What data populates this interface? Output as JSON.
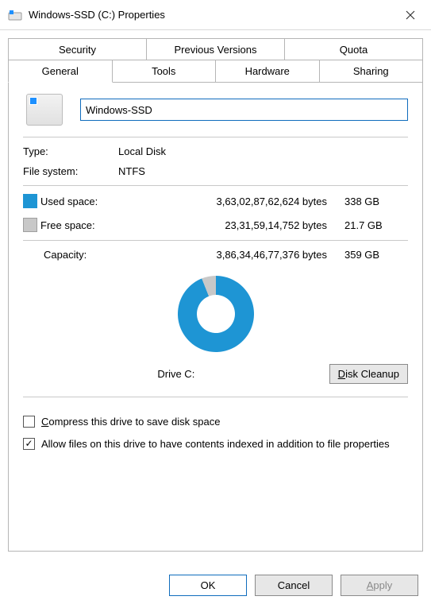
{
  "window": {
    "title": "Windows-SSD (C:) Properties"
  },
  "tabs": {
    "row1": [
      "Security",
      "Previous Versions",
      "Quota"
    ],
    "row2": [
      "General",
      "Tools",
      "Hardware",
      "Sharing"
    ],
    "active": "General"
  },
  "general": {
    "drive_name": "Windows-SSD",
    "type_label": "Type:",
    "type_value": "Local Disk",
    "fs_label": "File system:",
    "fs_value": "NTFS",
    "used_label": "Used space:",
    "used_bytes": "3,63,02,87,62,624 bytes",
    "used_gb": "338 GB",
    "free_label": "Free space:",
    "free_bytes": "23,31,59,14,752 bytes",
    "free_gb": "21.7 GB",
    "capacity_label": "Capacity:",
    "capacity_bytes": "3,86,34,46,77,376 bytes",
    "capacity_gb": "359 GB",
    "drive_label": "Drive C:",
    "cleanup_btn": "Disk Cleanup",
    "compress_label": "Compress this drive to save disk space",
    "compress_checked": false,
    "index_label": "Allow files on this drive to have contents indexed in addition to file properties",
    "index_checked": true
  },
  "chart_data": {
    "type": "pie",
    "title": "Drive C: usage",
    "series": [
      {
        "name": "Used space",
        "value": 338,
        "unit": "GB",
        "color": "#1e95d4"
      },
      {
        "name": "Free space",
        "value": 21.7,
        "unit": "GB",
        "color": "#c8c8c8"
      }
    ]
  },
  "colors": {
    "used": "#1e95d4",
    "free": "#c8c8c8",
    "accent": "#0f6cbd"
  },
  "buttons": {
    "ok": "OK",
    "cancel": "Cancel",
    "apply": "Apply"
  }
}
